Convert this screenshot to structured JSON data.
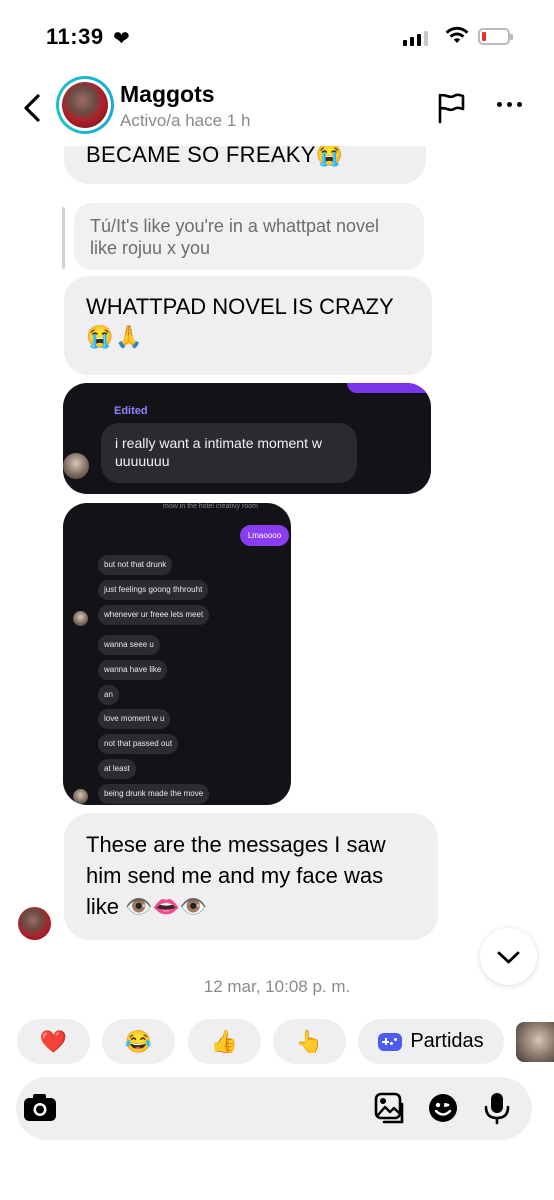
{
  "status_bar": {
    "time": "11:39",
    "heart": "❤"
  },
  "header": {
    "contact_name": "Maggots",
    "contact_status": "Activo/a hace 1 h",
    "icons": [
      "back-chevron-icon",
      "report-flag-icon",
      "more-dots-icon"
    ]
  },
  "messages": {
    "partial_text": "BECAME SO FREAKY😭",
    "reply_quote": "Tú/It's like you're in a whattpat novel like rojuu x you",
    "whattpad_text": "WHATTPAD NOVEL IS CRAZY",
    "whattpad_emoji": "😭🙏",
    "final_text": "These are the messages I saw him send me and my face was like 👁️👄👁️"
  },
  "screenshot1": {
    "edited_label": "Edited",
    "dm_text": "i really want a intimate moment w uuuuuuu"
  },
  "screenshot2": {
    "top_line": "mow in the hotel creativy room",
    "sent": "Lmaoooo",
    "lines": [
      "but not that drunk",
      "just feelings goong thhrouht",
      "whenever ur freee lets meet",
      "wanna seee u",
      "wanna have like",
      "an",
      "love moment w u",
      "not that passed out",
      "at least",
      "being drunk made the move"
    ]
  },
  "timestamp": "12 mar, 10:08 p. m.",
  "quick_reactions": {
    "heart": "❤️",
    "laugh": "😂",
    "thumbs": "👍",
    "point": "👆",
    "games_label": "Partidas"
  },
  "composer": {
    "icons": [
      "camera-icon",
      "gallery-icon",
      "sticker-icon",
      "microphone-icon"
    ]
  },
  "colors": {
    "accent_purple": "#8a3df0",
    "story_ring": "#13b7d6",
    "bubble_gray": "#efeff1"
  }
}
